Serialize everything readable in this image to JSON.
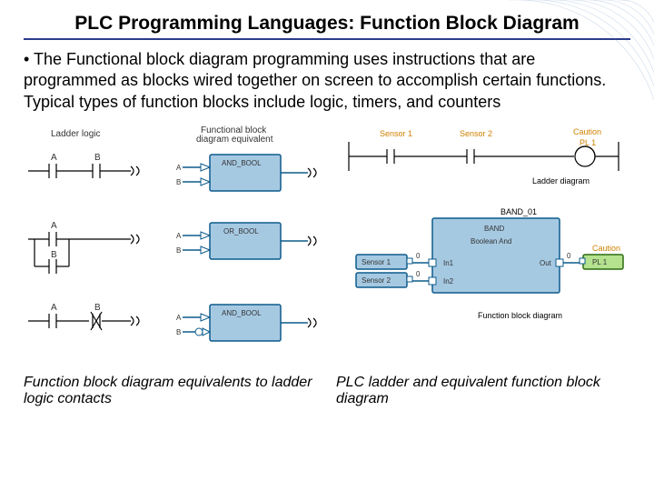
{
  "title": "PLC Programming Languages: Function Block Diagram",
  "bullet": "• The Functional block diagram programming uses instructions that are programmed as blocks wired together on screen to accomplish certain functions. Typical types of function blocks include logic, timers, and counters",
  "left": {
    "hdr_ladder": "Ladder logic",
    "hdr_fbd": "Functional block diagram equivalent",
    "labA": "A",
    "labB": "B",
    "block1": "AND_BOOL",
    "block2": "OR_BOOL",
    "block3": "AND_BOOL"
  },
  "right": {
    "sensor1": "Sensor 1",
    "sensor2": "Sensor 2",
    "caution": "Caution",
    "pl1": "PL 1",
    "ladder_label": "Ladder diagram",
    "band_title": "BAND_01",
    "band": "BAND",
    "band_desc": "Boolean And",
    "in1": "In1",
    "in2": "In2",
    "out": "Out",
    "zero": "0",
    "fbd_label": "Function block diagram"
  },
  "caption_left": "Function block diagram equivalents to ladder logic contacts",
  "caption_right": "PLC ladder and equivalent function block diagram"
}
